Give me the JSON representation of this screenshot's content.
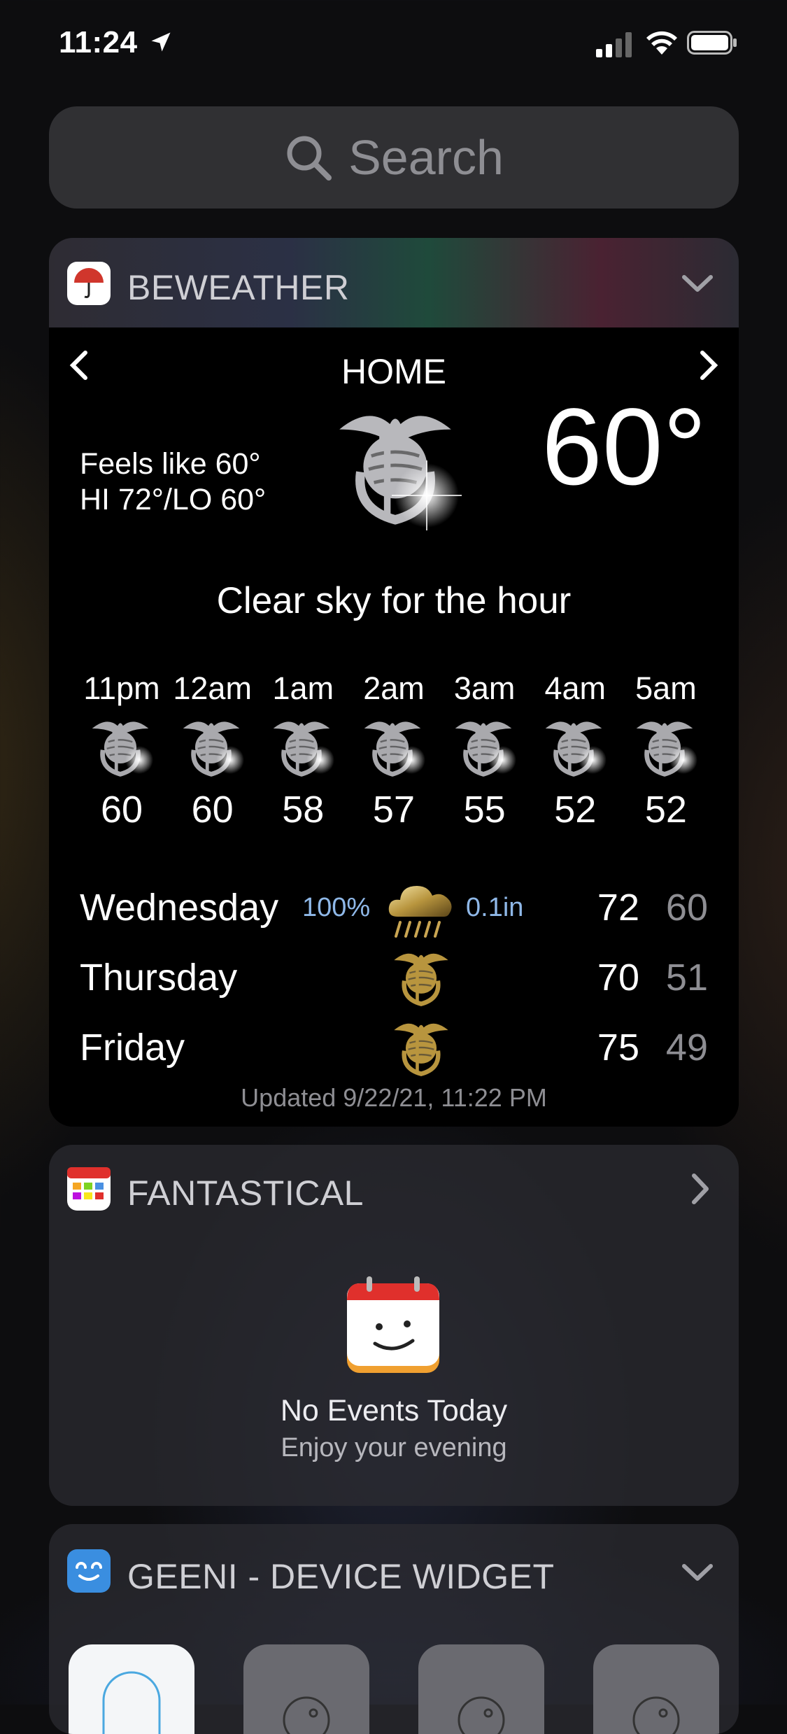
{
  "status_bar": {
    "time": "11:24"
  },
  "search": {
    "placeholder": "Search"
  },
  "beweather": {
    "app_name": "BEWEATHER",
    "location": "HOME",
    "feels_like": "Feels like 60°",
    "hi_lo": "HI 72°/LO 60°",
    "current_temp": "60°",
    "summary": "Clear sky for the hour",
    "hourly": [
      {
        "time": "11pm",
        "temp": "60"
      },
      {
        "time": "12am",
        "temp": "60"
      },
      {
        "time": "1am",
        "temp": "58"
      },
      {
        "time": "2am",
        "temp": "57"
      },
      {
        "time": "3am",
        "temp": "55"
      },
      {
        "time": "4am",
        "temp": "52"
      },
      {
        "time": "5am",
        "temp": "52"
      }
    ],
    "daily": [
      {
        "day": "Wednesday",
        "precip_chance": "100%",
        "precip_amount": "0.1in",
        "hi": "72",
        "lo": "60",
        "icon": "rain-cloud-icon"
      },
      {
        "day": "Thursday",
        "precip_chance": "",
        "precip_amount": "",
        "hi": "70",
        "lo": "51",
        "icon": "emblem-icon"
      },
      {
        "day": "Friday",
        "precip_chance": "",
        "precip_amount": "",
        "hi": "75",
        "lo": "49",
        "icon": "emblem-icon"
      }
    ],
    "updated": "Updated 9/22/21, 11:22 PM"
  },
  "fantastical": {
    "app_name": "FANTASTICAL",
    "no_events": "No Events Today",
    "subtitle": "Enjoy your evening"
  },
  "geeni": {
    "app_name": "GEENI - DEVICE WIDGET",
    "devices": [
      {
        "active": true
      },
      {
        "active": false
      },
      {
        "active": false
      },
      {
        "active": false
      }
    ]
  },
  "colors": {
    "precip_blue": "#8fb8e8",
    "muted_gray": "#8e8e93",
    "beweather_red": "#d0362c",
    "geeni_blue": "#3a8ee0"
  }
}
